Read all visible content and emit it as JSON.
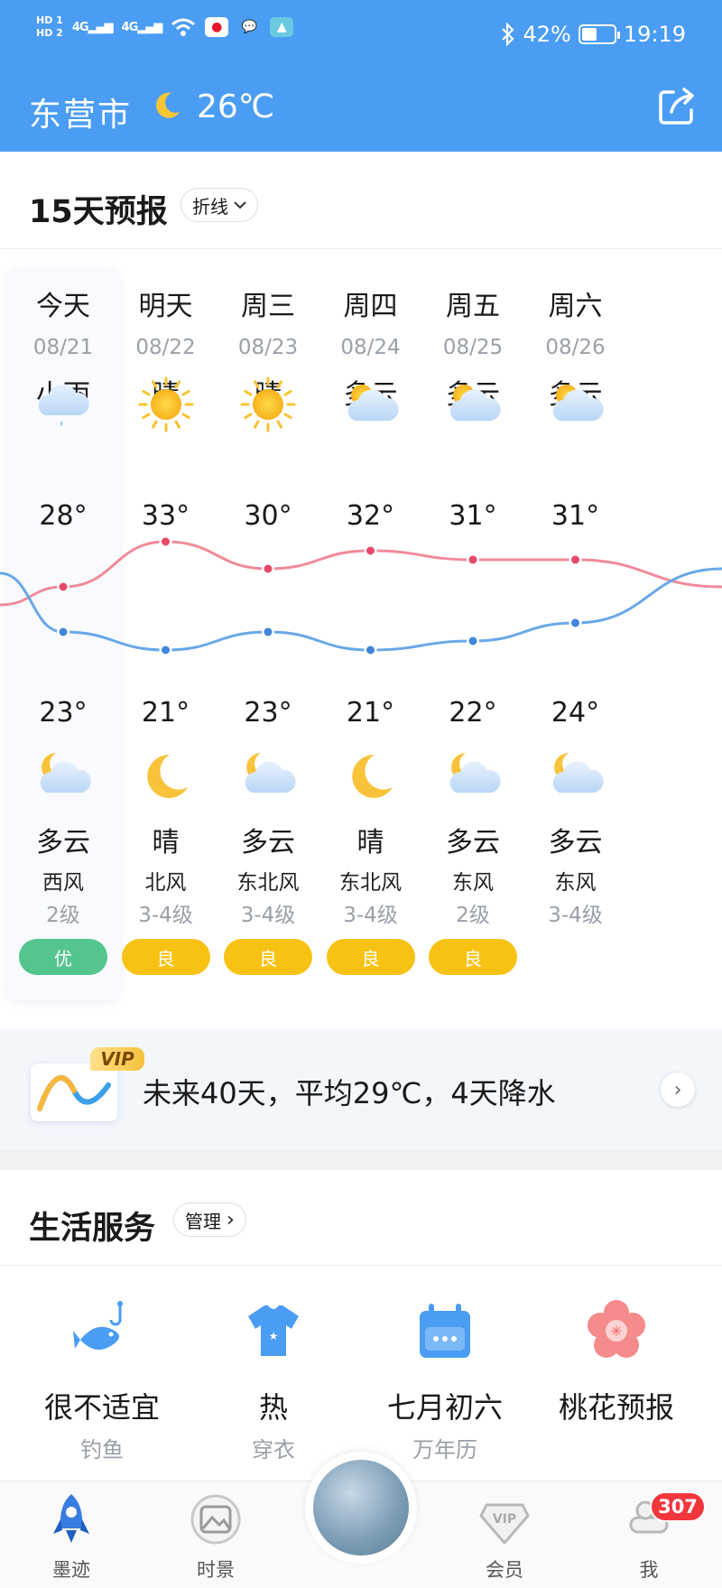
{
  "status_bar": {
    "hd1": "HD 1",
    "hd2": "HD 2",
    "net1": "4G",
    "net2": "4G",
    "battery_percent": "42%",
    "battery_level": 0.42,
    "time": "19:19"
  },
  "header": {
    "city": "东营市",
    "temperature": "26℃",
    "weather_icon": "moon-icon",
    "share_icon": "share-icon"
  },
  "forecast": {
    "title": "15天预报",
    "mode_chip": "折线",
    "days": [
      {
        "name": "今天",
        "date": "08/21",
        "day_weather": "小雨",
        "day_icon": "rain-cloud",
        "high": "28°",
        "low": "23°",
        "night_icon": "moon-cloud",
        "night_weather": "多云",
        "wind": "西风",
        "wind_level": "2级",
        "aqi": "优",
        "aqi_color": "#54c58f"
      },
      {
        "name": "明天",
        "date": "08/22",
        "day_weather": "晴",
        "day_icon": "sun",
        "high": "33°",
        "low": "21°",
        "night_icon": "moon",
        "night_weather": "晴",
        "wind": "北风",
        "wind_level": "3-4级",
        "aqi": "良",
        "aqi_color": "#f8c215"
      },
      {
        "name": "周三",
        "date": "08/23",
        "day_weather": "晴",
        "day_icon": "sun",
        "high": "30°",
        "low": "23°",
        "night_icon": "moon-cloud",
        "night_weather": "多云",
        "wind": "东北风",
        "wind_level": "3-4级",
        "aqi": "良",
        "aqi_color": "#f8c215"
      },
      {
        "name": "周四",
        "date": "08/24",
        "day_weather": "多云",
        "day_icon": "sun-cloud",
        "high": "32°",
        "low": "21°",
        "night_icon": "moon",
        "night_weather": "晴",
        "wind": "东北风",
        "wind_level": "3-4级",
        "aqi": "良",
        "aqi_color": "#f8c215"
      },
      {
        "name": "周五",
        "date": "08/25",
        "day_weather": "多云",
        "day_icon": "sun-cloud",
        "high": "31°",
        "low": "22°",
        "night_icon": "moon-cloud",
        "night_weather": "多云",
        "wind": "东风",
        "wind_level": "2级",
        "aqi": "良",
        "aqi_color": "#f8c215"
      },
      {
        "name": "周六",
        "date": "08/26",
        "day_weather": "多云",
        "day_icon": "sun-cloud",
        "high": "31°",
        "low": "24°",
        "night_icon": "moon-cloud",
        "night_weather": "多云",
        "wind": "东风",
        "wind_level": "3-4级",
        "aqi": "",
        "aqi_color": ""
      }
    ],
    "high_curve_color": "#f08a9a",
    "low_curve_color": "#69a8e8"
  },
  "vip_banner": {
    "badge": "VIP",
    "text": "未来40天，平均29℃，4天降水"
  },
  "life_services": {
    "title": "生活服务",
    "manage_chip": "管理",
    "items": [
      {
        "main": "很不适宜",
        "sub": "钓鱼",
        "icon": "fish-icon"
      },
      {
        "main": "热",
        "sub": "穿衣",
        "icon": "shirt-icon"
      },
      {
        "main": "七月初六",
        "sub": "万年历",
        "icon": "calendar-icon"
      },
      {
        "main": "桃花预报",
        "sub": "",
        "icon": "blossom-icon"
      }
    ]
  },
  "bottom_nav": {
    "items": [
      {
        "label": "墨迹",
        "icon": "rocket-icon"
      },
      {
        "label": "时景",
        "icon": "photo-icon"
      },
      {
        "label": "会员",
        "icon": "vip-icon"
      },
      {
        "label": "我",
        "icon": "user-icon"
      }
    ],
    "badge": "307"
  }
}
